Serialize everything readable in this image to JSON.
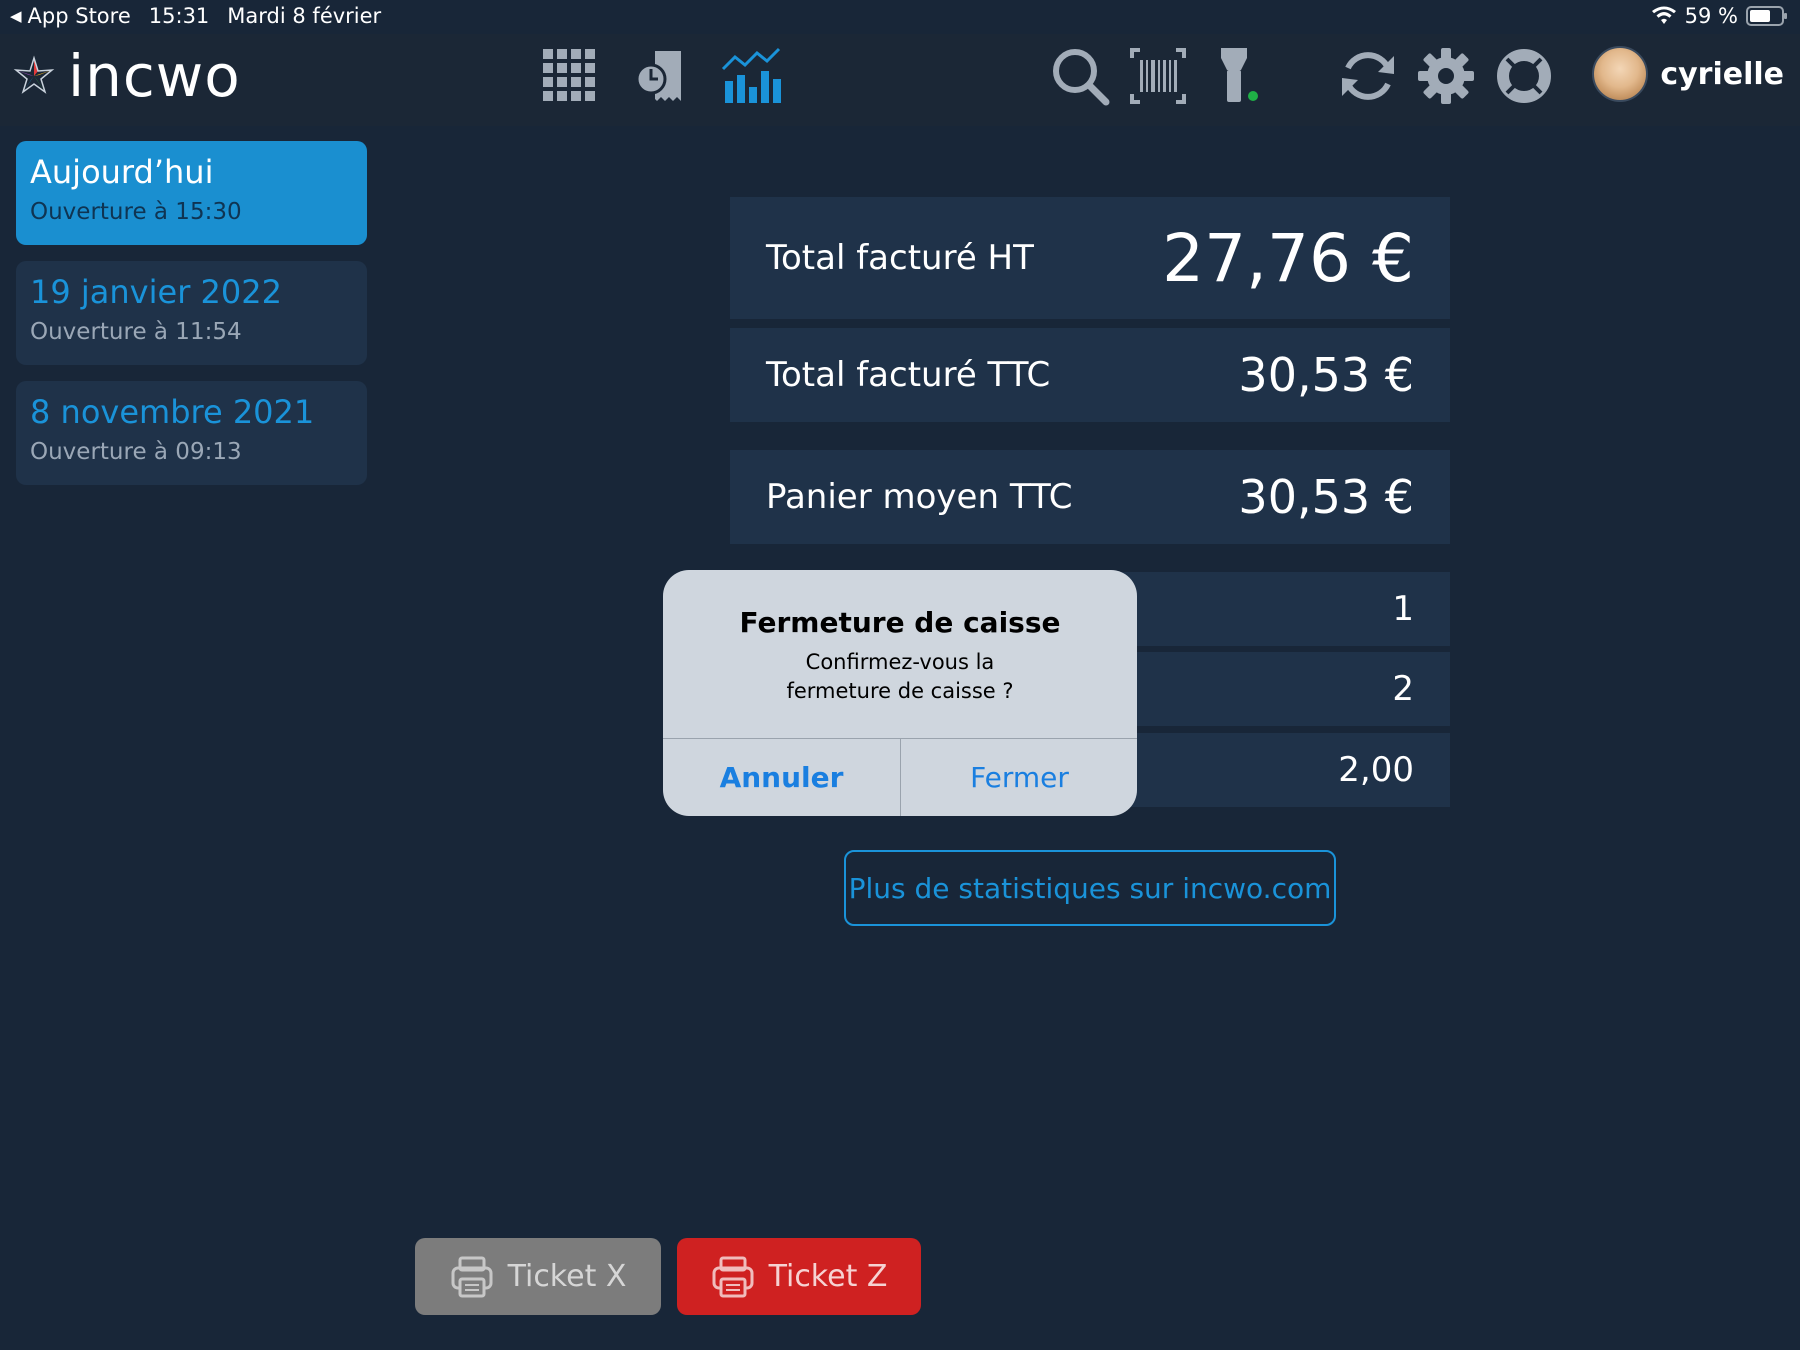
{
  "status_bar": {
    "back_label": "App Store",
    "time": "15:31",
    "date": "Mardi 8 février",
    "battery": "59 %"
  },
  "app": {
    "name": "incwo",
    "accent_color": "#1a93d9"
  },
  "toolbar": {
    "icons": [
      "grid-icon",
      "receipt-clock-icon",
      "stats-chart-icon",
      "search-icon",
      "barcode-icon",
      "flashlight-icon",
      "sync-icon",
      "gear-icon",
      "lifebuoy-icon"
    ]
  },
  "user": {
    "name": "cyrielle"
  },
  "sessions": [
    {
      "title": "Aujourd’hui",
      "subtitle": "Ouverture à 15:30",
      "active": true
    },
    {
      "title": "19 janvier 2022",
      "subtitle": "Ouverture à 11:54",
      "active": false
    },
    {
      "title": "8 novembre 2021",
      "subtitle": "Ouverture à 09:13",
      "active": false
    }
  ],
  "stats": [
    {
      "label": "Total facturé HT",
      "value": "27,76 €"
    },
    {
      "label": "Total facturé TTC",
      "value": "30,53 €"
    },
    {
      "label": "Panier moyen TTC",
      "value": "30,53 €"
    },
    {
      "label": "",
      "value": "1"
    },
    {
      "label": "",
      "value": "2"
    },
    {
      "label": "",
      "value": "2,00"
    }
  ],
  "more_stats_link": "Plus de statistiques sur incwo.com",
  "tickets": {
    "x_label": "Ticket X",
    "z_label": "Ticket Z"
  },
  "alert": {
    "title": "Fermeture de caisse",
    "message_line1": "Confirmez-vous la",
    "message_line2": "fermeture de caisse ?",
    "cancel_label": "Annuler",
    "confirm_label": "Fermer"
  }
}
